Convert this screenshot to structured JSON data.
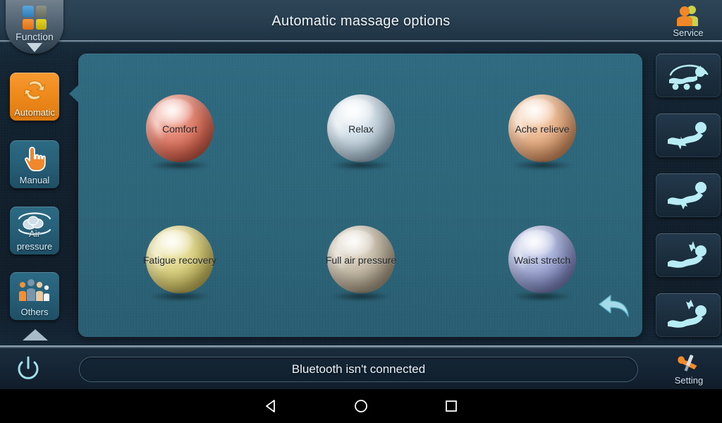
{
  "header": {
    "title": "Automatic massage options",
    "function_tab": {
      "label": "Function",
      "icon": "grid-four-color-icon",
      "chevron": "chevron-down-icon"
    },
    "service": {
      "label": "Service",
      "icon": "service-people-icon"
    }
  },
  "sidebar": {
    "items": [
      {
        "id": "automatic",
        "label": "Automatic",
        "icon": "recycle-arrows-icon",
        "active": true
      },
      {
        "id": "manual",
        "label": "Manual",
        "icon": "hand-pointer-icon",
        "active": false
      },
      {
        "id": "air-pressure",
        "label_top": "Air",
        "label": "pressure",
        "icon": "air-cloud-icon",
        "active": false
      },
      {
        "id": "others",
        "label": "Others",
        "icon": "people-group-icon",
        "active": false
      }
    ],
    "more": {
      "icon": "chevron-up-icon"
    }
  },
  "main": {
    "programs": [
      {
        "id": "comfort",
        "label": "Comfort",
        "color": "#e0705e"
      },
      {
        "id": "relax",
        "label": "Relax",
        "color": "#b8cbd8"
      },
      {
        "id": "ache-relieve",
        "label": "Ache relieve",
        "color": "#e2a075"
      },
      {
        "id": "fatigue-recovery",
        "label": "Fatigue recovery",
        "color": "#d8d37a"
      },
      {
        "id": "full-air-pressure",
        "label": "Full air pressure",
        "color": "#b6aa96"
      },
      {
        "id": "waist-stretch",
        "label": "Waist stretch",
        "color": "#7b86c4"
      }
    ],
    "back": {
      "icon": "back-arrow-icon"
    }
  },
  "right_rail": {
    "buttons": [
      {
        "id": "massage-program",
        "icon": "body-rollers-icon"
      },
      {
        "id": "backrest-up",
        "icon": "recline-arrow-up-left-icon"
      },
      {
        "id": "backrest-down",
        "icon": "recline-arrow-down-right-icon"
      },
      {
        "id": "legrest-down",
        "icon": "recline-head-arrow-down-icon"
      },
      {
        "id": "legrest-up",
        "icon": "recline-head-arrow-up-icon"
      }
    ]
  },
  "bottom": {
    "power": {
      "icon": "power-icon"
    },
    "status": "Bluetooth isn't connected",
    "setting": {
      "label": "Setting",
      "icon": "wrench-screwdriver-icon"
    }
  },
  "navbar": {
    "back": {
      "icon": "triangle-back-icon"
    },
    "home": {
      "icon": "circle-home-icon"
    },
    "recents": {
      "icon": "square-recents-icon"
    }
  },
  "colors": {
    "panel": "#2d6578",
    "accent_orange": "#ef8a1c",
    "rail_icon": "#b8ecf4",
    "background": "#101d2a"
  }
}
